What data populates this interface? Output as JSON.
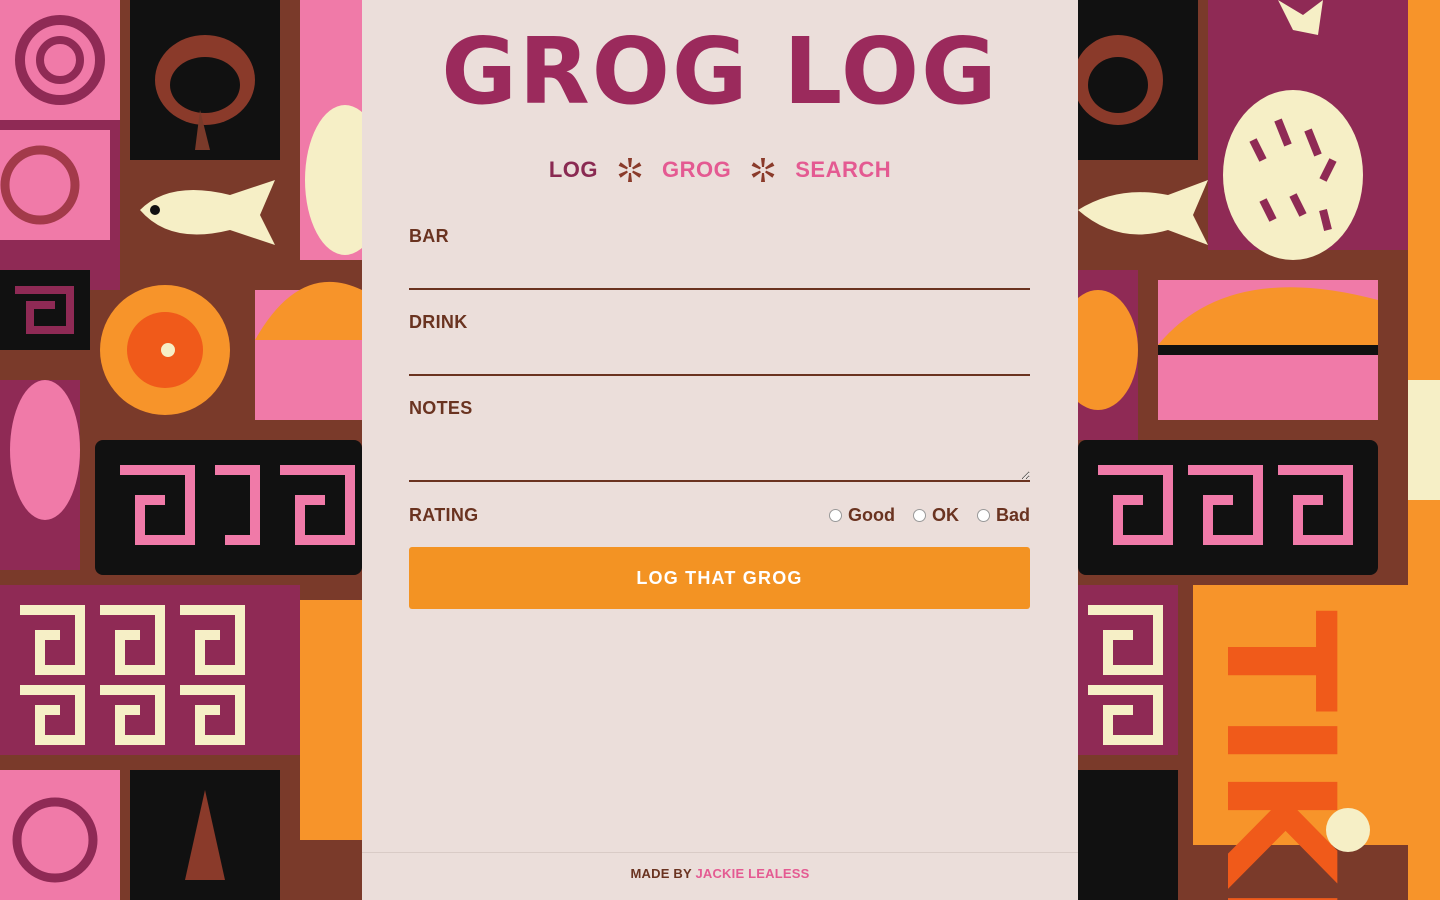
{
  "app": {
    "title": "GROG LOG"
  },
  "nav": {
    "items": [
      {
        "label": "LOG"
      },
      {
        "label": "GROG"
      },
      {
        "label": "SEARCH"
      }
    ]
  },
  "form": {
    "bar_label": "BAR",
    "bar_value": "",
    "drink_label": "DRINK",
    "drink_value": "",
    "notes_label": "NOTES",
    "notes_value": "",
    "rating_label": "RATING",
    "rating_options": [
      {
        "label": "Good",
        "selected": false
      },
      {
        "label": "OK",
        "selected": false
      },
      {
        "label": "Bad",
        "selected": false
      }
    ],
    "submit_label": "LOG THAT GROG"
  },
  "footer": {
    "prefix": "MADE BY",
    "author": "JACKIE LEALESS"
  },
  "colors": {
    "panel_bg": "#ebdeda",
    "brand": "#9b2a5c",
    "accent_pink": "#e45a92",
    "label_brown": "#6a3320",
    "button_orange": "#f39323"
  }
}
